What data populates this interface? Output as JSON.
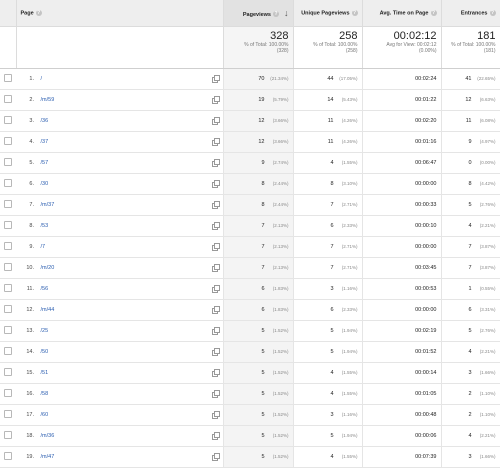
{
  "headers": {
    "page": "Page",
    "pageviews": "Pageviews",
    "unique": "Unique Pageviews",
    "avg_time": "Avg. Time on Page",
    "entrances": "Entrances"
  },
  "totals": {
    "pageviews": {
      "value": "328",
      "l1": "% of Total: 100.00%",
      "l2": "(328)"
    },
    "unique": {
      "value": "258",
      "l1": "% of Total: 100.00%",
      "l2": "(258)"
    },
    "avg_time": {
      "value": "00:02:12",
      "l1": "Avg for View: 00:02:12",
      "l2": "(0.00%)"
    },
    "entrances": {
      "value": "181",
      "l1": "% of Total: 100.00%",
      "l2": "(181)"
    }
  },
  "rows": [
    {
      "idx": "1.",
      "page": "/",
      "pv": "70",
      "pv_pct": "(21.34%)",
      "upv": "44",
      "upv_pct": "(17.05%)",
      "avg": "00:02:24",
      "ent": "41",
      "ent_pct": "(22.65%)"
    },
    {
      "idx": "2.",
      "page": "/m/59",
      "pv": "19",
      "pv_pct": "(5.79%)",
      "upv": "14",
      "upv_pct": "(5.43%)",
      "avg": "00:01:22",
      "ent": "12",
      "ent_pct": "(6.63%)"
    },
    {
      "idx": "3.",
      "page": "/36",
      "pv": "12",
      "pv_pct": "(3.66%)",
      "upv": "11",
      "upv_pct": "(4.26%)",
      "avg": "00:02:20",
      "ent": "11",
      "ent_pct": "(6.08%)"
    },
    {
      "idx": "4.",
      "page": "/37",
      "pv": "12",
      "pv_pct": "(3.66%)",
      "upv": "11",
      "upv_pct": "(4.26%)",
      "avg": "00:01:16",
      "ent": "9",
      "ent_pct": "(4.97%)"
    },
    {
      "idx": "5.",
      "page": "/57",
      "pv": "9",
      "pv_pct": "(2.74%)",
      "upv": "4",
      "upv_pct": "(1.55%)",
      "avg": "00:06:47",
      "ent": "0",
      "ent_pct": "(0.00%)"
    },
    {
      "idx": "6.",
      "page": "/30",
      "pv": "8",
      "pv_pct": "(2.44%)",
      "upv": "8",
      "upv_pct": "(3.10%)",
      "avg": "00:00:00",
      "ent": "8",
      "ent_pct": "(4.42%)"
    },
    {
      "idx": "7.",
      "page": "/m/37",
      "pv": "8",
      "pv_pct": "(2.44%)",
      "upv": "7",
      "upv_pct": "(2.71%)",
      "avg": "00:00:33",
      "ent": "5",
      "ent_pct": "(2.76%)"
    },
    {
      "idx": "8.",
      "page": "/53",
      "pv": "7",
      "pv_pct": "(2.13%)",
      "upv": "6",
      "upv_pct": "(2.33%)",
      "avg": "00:00:10",
      "ent": "4",
      "ent_pct": "(2.21%)"
    },
    {
      "idx": "9.",
      "page": "/7",
      "pv": "7",
      "pv_pct": "(2.13%)",
      "upv": "7",
      "upv_pct": "(2.71%)",
      "avg": "00:00:00",
      "ent": "7",
      "ent_pct": "(3.87%)"
    },
    {
      "idx": "10.",
      "page": "/m/20",
      "pv": "7",
      "pv_pct": "(2.13%)",
      "upv": "7",
      "upv_pct": "(2.71%)",
      "avg": "00:03:45",
      "ent": "7",
      "ent_pct": "(3.87%)"
    },
    {
      "idx": "11.",
      "page": "/56",
      "pv": "6",
      "pv_pct": "(1.83%)",
      "upv": "3",
      "upv_pct": "(1.16%)",
      "avg": "00:00:53",
      "ent": "1",
      "ent_pct": "(0.55%)"
    },
    {
      "idx": "12.",
      "page": "/m/44",
      "pv": "6",
      "pv_pct": "(1.83%)",
      "upv": "6",
      "upv_pct": "(2.33%)",
      "avg": "00:00:00",
      "ent": "6",
      "ent_pct": "(3.31%)"
    },
    {
      "idx": "13.",
      "page": "/25",
      "pv": "5",
      "pv_pct": "(1.52%)",
      "upv": "5",
      "upv_pct": "(1.94%)",
      "avg": "00:02:19",
      "ent": "5",
      "ent_pct": "(2.76%)"
    },
    {
      "idx": "14.",
      "page": "/50",
      "pv": "5",
      "pv_pct": "(1.52%)",
      "upv": "5",
      "upv_pct": "(1.94%)",
      "avg": "00:01:52",
      "ent": "4",
      "ent_pct": "(2.21%)"
    },
    {
      "idx": "15.",
      "page": "/51",
      "pv": "5",
      "pv_pct": "(1.52%)",
      "upv": "4",
      "upv_pct": "(1.55%)",
      "avg": "00:00:14",
      "ent": "3",
      "ent_pct": "(1.66%)"
    },
    {
      "idx": "16.",
      "page": "/58",
      "pv": "5",
      "pv_pct": "(1.52%)",
      "upv": "4",
      "upv_pct": "(1.55%)",
      "avg": "00:01:05",
      "ent": "2",
      "ent_pct": "(1.10%)"
    },
    {
      "idx": "17.",
      "page": "/60",
      "pv": "5",
      "pv_pct": "(1.52%)",
      "upv": "3",
      "upv_pct": "(1.16%)",
      "avg": "00:00:48",
      "ent": "2",
      "ent_pct": "(1.10%)"
    },
    {
      "idx": "18.",
      "page": "/m/36",
      "pv": "5",
      "pv_pct": "(1.52%)",
      "upv": "5",
      "upv_pct": "(1.94%)",
      "avg": "00:00:06",
      "ent": "4",
      "ent_pct": "(2.21%)"
    },
    {
      "idx": "19.",
      "page": "/m/47",
      "pv": "5",
      "pv_pct": "(1.52%)",
      "upv": "4",
      "upv_pct": "(1.55%)",
      "avg": "00:07:39",
      "ent": "3",
      "ent_pct": "(1.66%)"
    }
  ]
}
